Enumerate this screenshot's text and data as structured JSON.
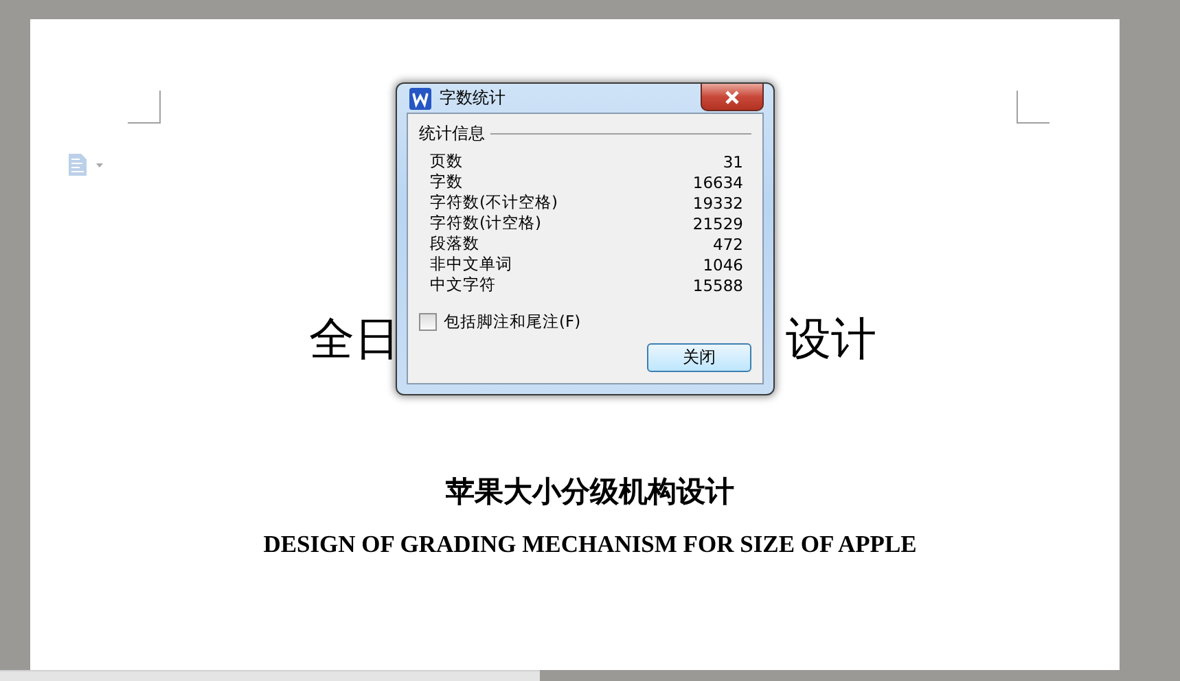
{
  "document": {
    "heading_fragments": [
      "全日",
      "设计"
    ],
    "title": "苹果大小分级机构设计",
    "subtitle": "DESIGN OF GRADING MECHANISM FOR SIZE OF APPLE"
  },
  "dialog": {
    "title": "字数统计",
    "section": "统计信息",
    "stats": [
      {
        "label": "页数",
        "value": "31"
      },
      {
        "label": "字数",
        "value": "16634"
      },
      {
        "label": "字符数(不计空格)",
        "value": "19332"
      },
      {
        "label": "字符数(计空格)",
        "value": "21529"
      },
      {
        "label": "段落数",
        "value": "472"
      },
      {
        "label": "非中文单词",
        "value": "1046"
      },
      {
        "label": "中文字符",
        "value": "15588"
      }
    ],
    "include_notes": {
      "label": "包括脚注和尾注(F)",
      "checked": false
    },
    "button": "关闭"
  }
}
